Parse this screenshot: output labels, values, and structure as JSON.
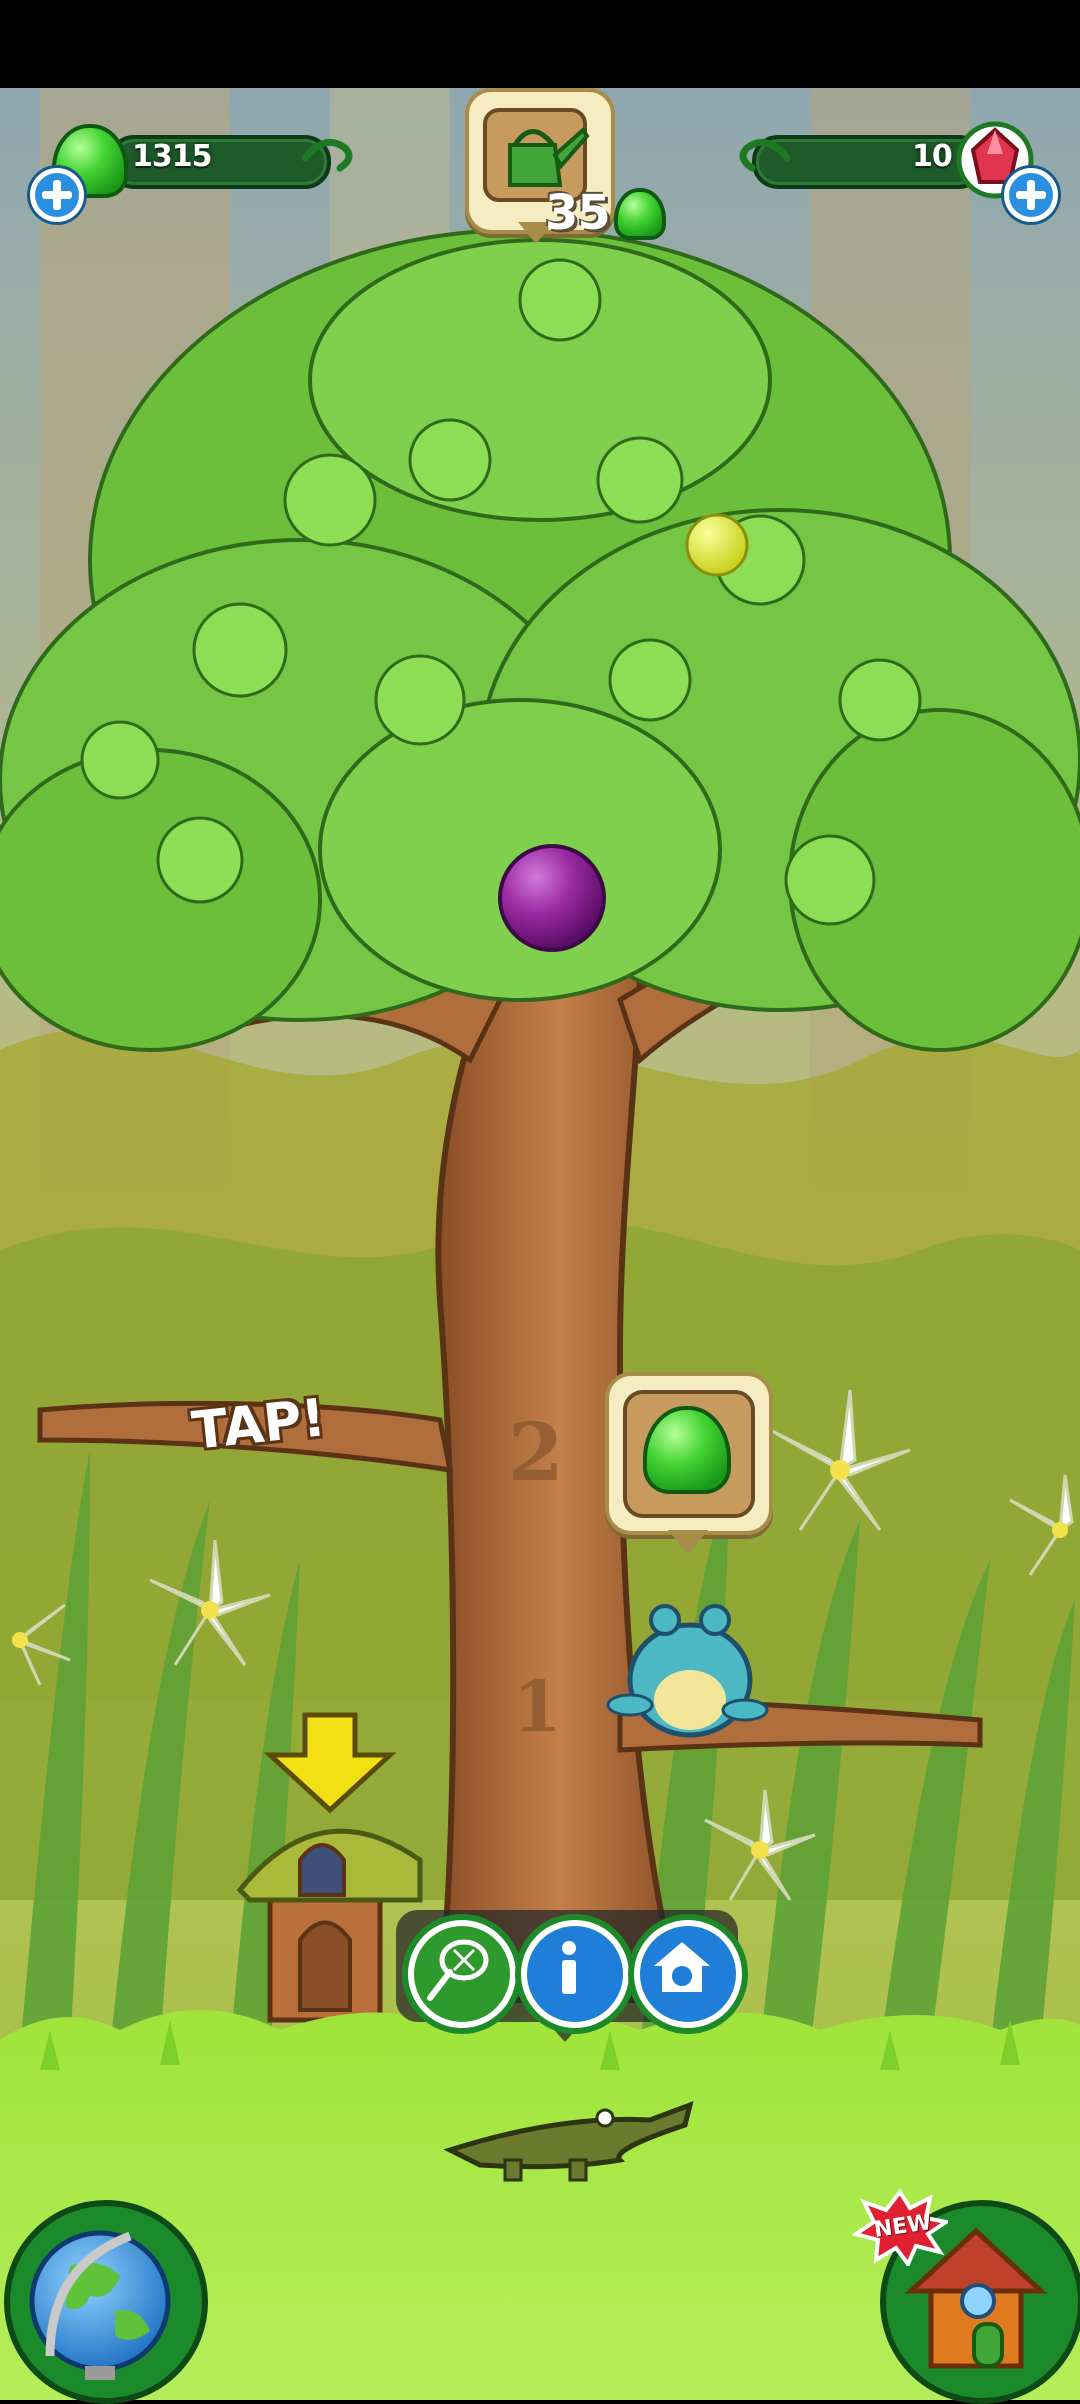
{
  "hud": {
    "gumdrops": "1315",
    "gems": "10",
    "watering_cost": "35"
  },
  "scene": {
    "tap_label": "TAP!",
    "trunk_marks": [
      "2",
      "1"
    ]
  },
  "buttons": {
    "new_badge": "NEW"
  },
  "colors": {
    "hud_bar": "#1f5b2a",
    "grass": "#a6e23b",
    "trunk": "#b06e3c",
    "leaves": "#6cbf3a",
    "sky_top": "#000000"
  }
}
